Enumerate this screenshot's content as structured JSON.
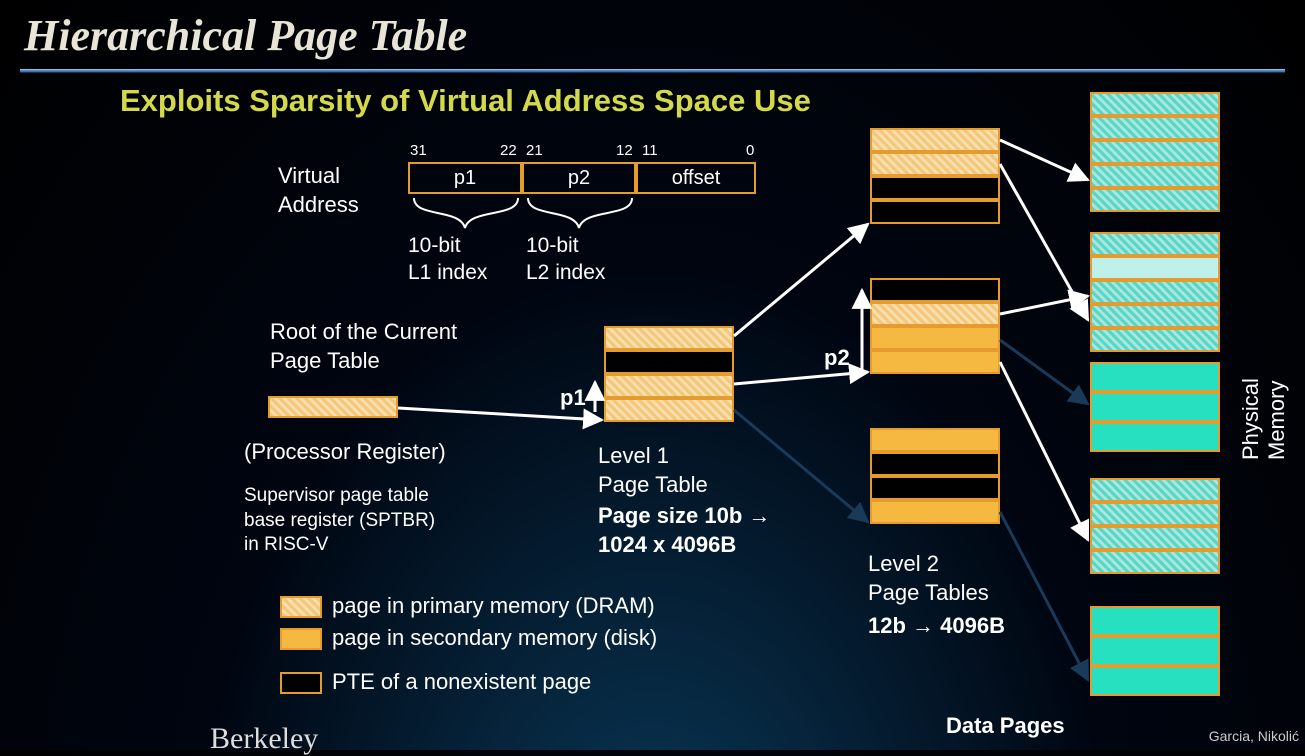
{
  "title": "Hierarchical Page Table",
  "subtitle": "Exploits Sparsity of Virtual Address Space Use",
  "va": {
    "label": "Virtual\nAddress",
    "bits": [
      "31",
      "22",
      "21",
      "12",
      "11",
      "0"
    ],
    "fields": [
      "p1",
      "p2",
      "offset"
    ],
    "idx1": "10-bit\nL1 index",
    "idx2": "10-bit\nL2 index"
  },
  "root_label": "Root of the Current\nPage Table",
  "proc_reg": "(Processor Register)",
  "sptbr": "Supervisor page table\nbase register (SPTBR)\nin RISC-V",
  "p1": "p1",
  "p2": "p2",
  "l1": {
    "label": "Level 1\nPage Table",
    "size": "Page size 10b →\n1024 x 4096B"
  },
  "l2": {
    "label": "Level 2\nPage Tables",
    "size": "12b → 4096B"
  },
  "legend": {
    "dram": "page in primary memory (DRAM)",
    "disk": "page in secondary memory (disk)",
    "none": "PTE of a nonexistent page"
  },
  "phys_mem": "Physical Memory",
  "data_pages": "Data Pages",
  "credit": "Garcia, Nikolić",
  "berkeley": "Berkeley"
}
